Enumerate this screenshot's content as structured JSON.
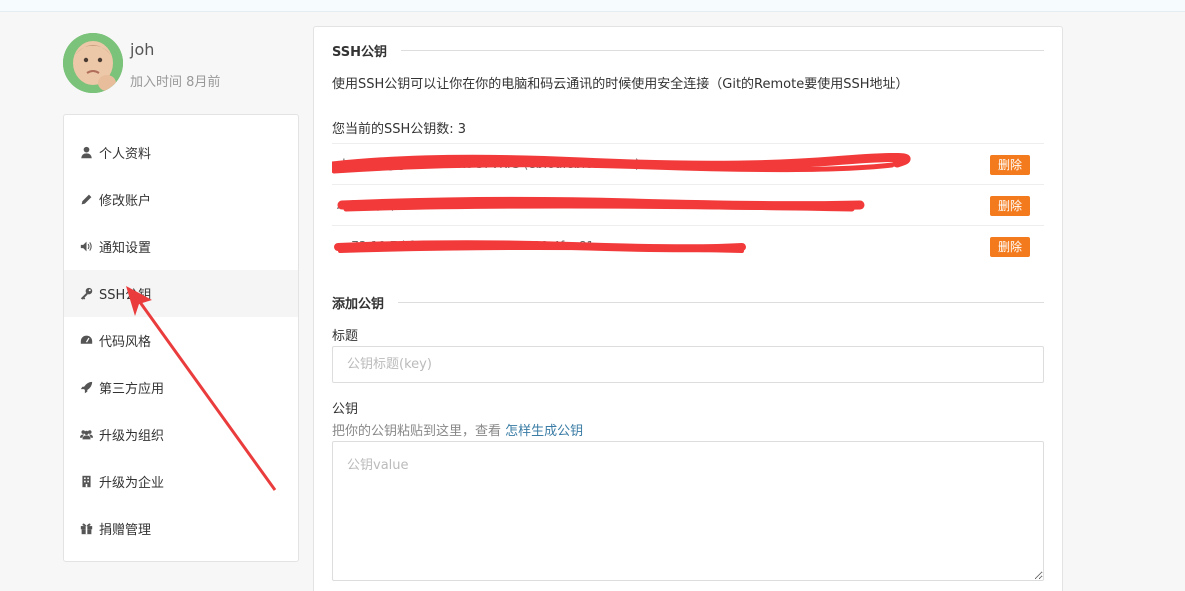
{
  "user": {
    "name": "joh",
    "joined": "加入时间 8月前"
  },
  "sidebar": {
    "items": [
      {
        "label": "个人资料",
        "icon": "user-icon"
      },
      {
        "label": "修改账户",
        "icon": "pencil-icon"
      },
      {
        "label": "通知设置",
        "icon": "volume-icon"
      },
      {
        "label": "SSH公钥",
        "icon": "key-icon"
      },
      {
        "label": "代码风格",
        "icon": "dashboard-icon"
      },
      {
        "label": "第三方应用",
        "icon": "rocket-icon"
      },
      {
        "label": "升级为组织",
        "icon": "users-icon"
      },
      {
        "label": "升级为企业",
        "icon": "building-icon"
      },
      {
        "label": "捐赠管理",
        "icon": "gift-icon"
      }
    ],
    "active_index": 3
  },
  "ssh": {
    "title": "SSH公钥",
    "description": "使用SSH公钥可以让你在你的电脑和码云通讯的时候使用安全连接（Git的Remote要使用SSH地址）",
    "count_label": "您当前的SSH公钥数: 3",
    "keys": [
      {
        "text": "zhaoheng@LAPTOP-KOG7VKIG (eb:8a:eb:65:ea:...)",
        "delete_label": "删除"
      },
      {
        "text": "...@... (...)",
        "delete_label": "删除"
      },
      {
        "text": "... 73:10:7d:f1:...:d3:65:...:d61...:00:4f...:81...",
        "delete_label": "删除"
      }
    ]
  },
  "add_key": {
    "title": "添加公钥",
    "title_label": "标题",
    "title_placeholder": "公钥标题(key)",
    "key_label": "公钥",
    "hint_prefix": "把你的公钥粘贴到这里，查看 ",
    "hint_link": "怎样生成公钥",
    "key_placeholder": "公钥value"
  },
  "colors": {
    "delete_button": "#f37b1d",
    "redaction": "#f23a3a",
    "annotation_arrow": "#ea3c3c"
  }
}
